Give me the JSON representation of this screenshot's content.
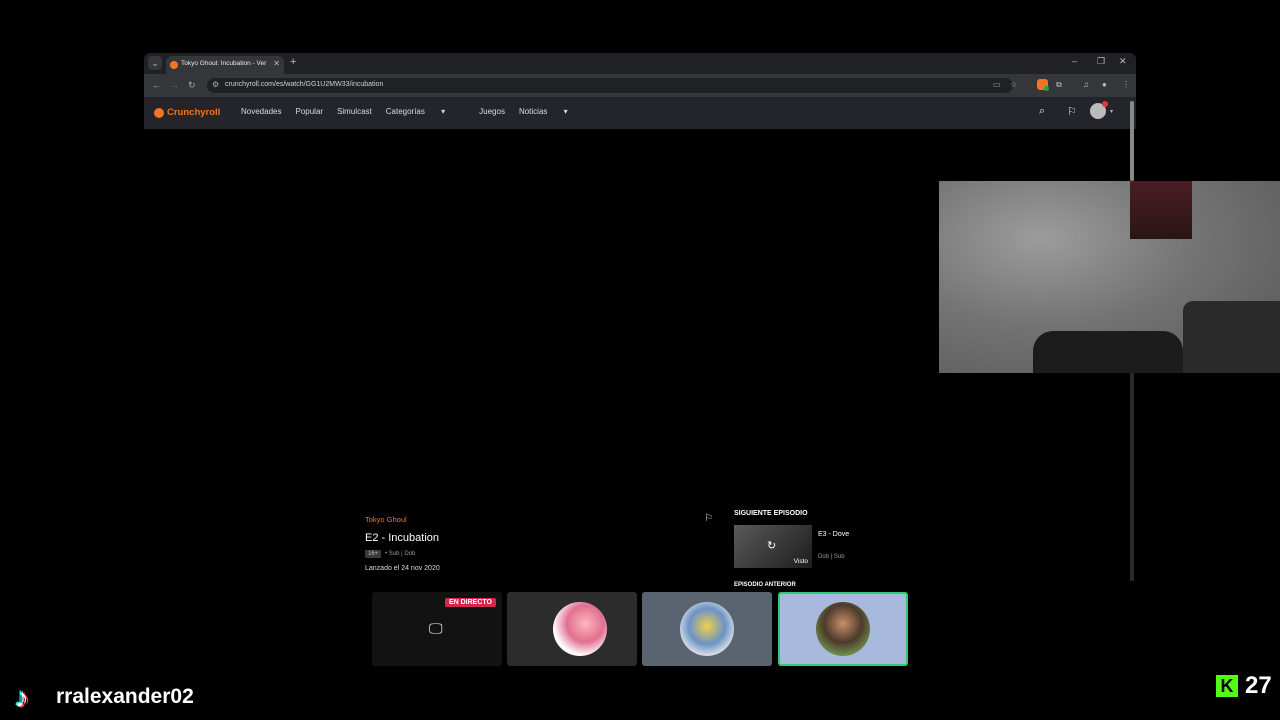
{
  "browser": {
    "tab_title": "Tokyo Ghoul: Incubation - Ver e",
    "url": "crunchyroll.com/es/watch/GG1U2MW33/incubation"
  },
  "crunchyroll": {
    "logo": "Crunchyroll",
    "nav": [
      "Novedades",
      "Popular",
      "Simulcast",
      "Categorías",
      "Juegos",
      "Noticias"
    ]
  },
  "episode": {
    "series": "Tokyo Ghoul",
    "title": "E2 - Incubation",
    "rating": "16+",
    "audio": "• Sub | Dob",
    "released": "Lanzado el 24 nov 2020"
  },
  "next_episode": {
    "label": "SIGUIENTE EPISODIO",
    "title": "E3 - Dove",
    "audio": "Dob | Sub",
    "watched": "Visto"
  },
  "prev_episode": {
    "label": "EPISODIO ANTERIOR"
  },
  "stream": {
    "live_badge": "EN DIRECTO",
    "username": "rralexander02",
    "viewer_count": "27",
    "kick_logo": "K"
  },
  "colors": {
    "brand": "#f47521",
    "live": "#d6264b",
    "kick": "#53fc18",
    "active_border": "#2ecc71"
  }
}
